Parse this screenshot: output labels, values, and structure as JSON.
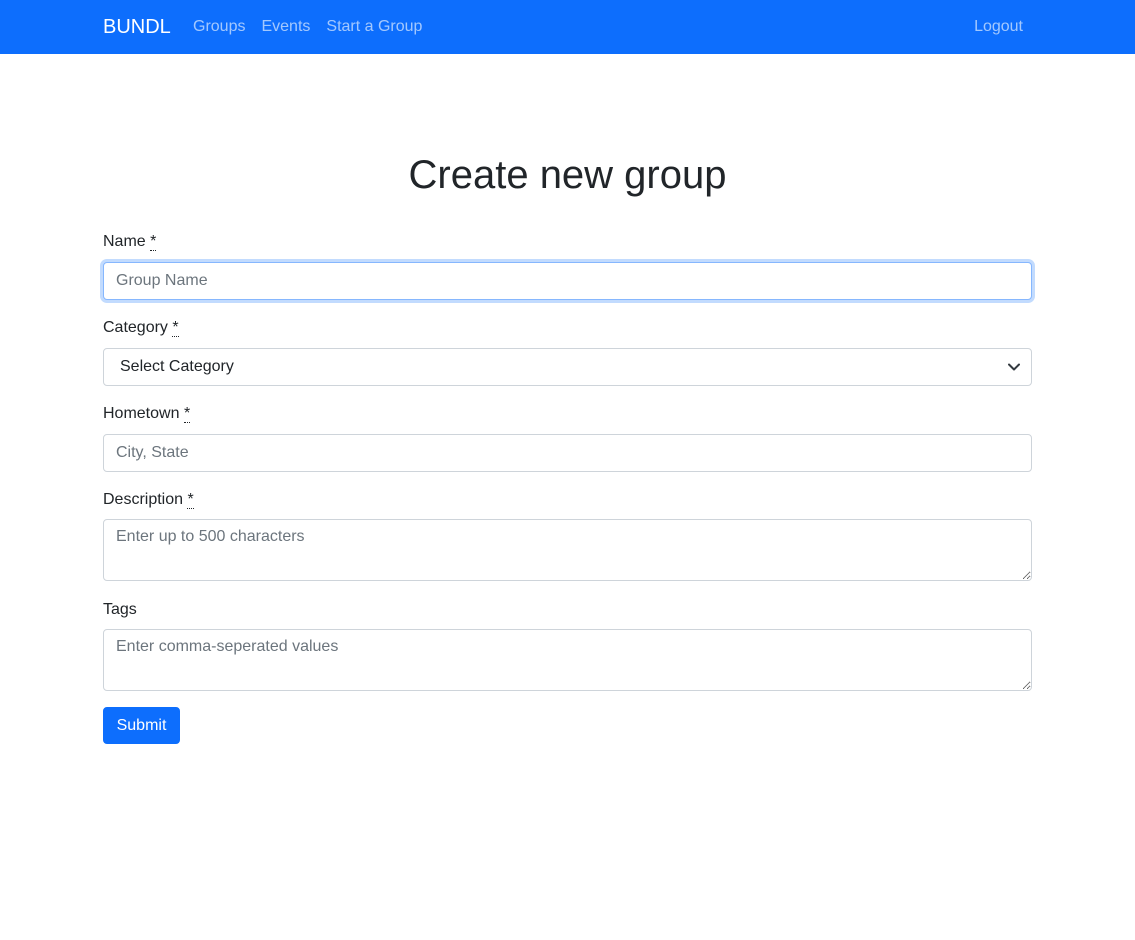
{
  "navbar": {
    "brand": "BUNDL",
    "links": [
      "Groups",
      "Events",
      "Start a Group"
    ],
    "logout": "Logout"
  },
  "page": {
    "title": "Create new group"
  },
  "form": {
    "required_marker": "*",
    "name": {
      "label": "Name",
      "placeholder": "Group Name",
      "value": ""
    },
    "category": {
      "label": "Category",
      "selected": "Select Category"
    },
    "hometown": {
      "label": "Hometown",
      "placeholder": "City, State",
      "value": ""
    },
    "description": {
      "label": "Description",
      "placeholder": "Enter up to 500 characters"
    },
    "tags": {
      "label": "Tags",
      "placeholder": "Enter comma-seperated values"
    },
    "submit_label": "Submit"
  },
  "colors": {
    "primary": "#0d6efd",
    "focus_border": "#86b7fe",
    "input_border": "#ced4da"
  }
}
